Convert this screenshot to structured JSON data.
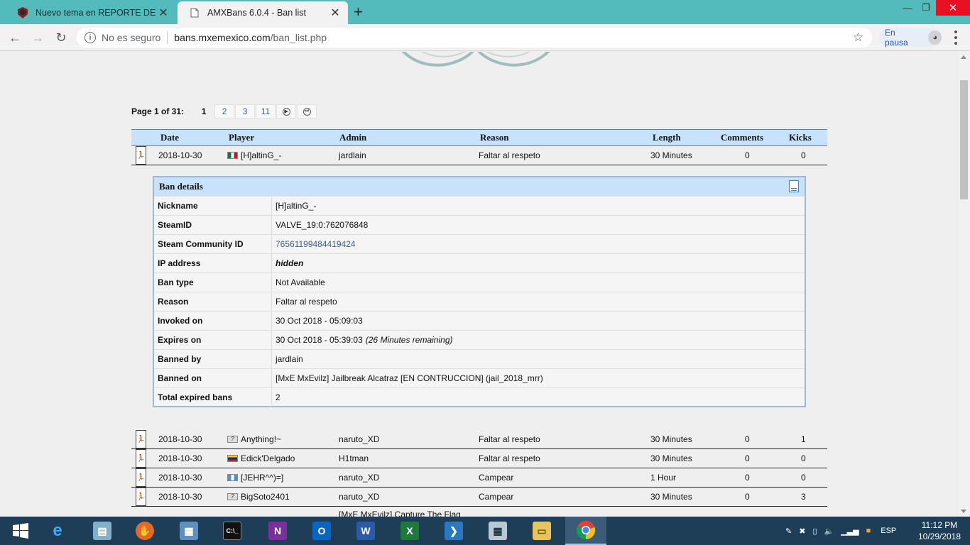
{
  "browser": {
    "tabs": [
      {
        "title": "Nuevo tema en REPORTE DE ABU",
        "active": false
      },
      {
        "title": "AMXBans 6.0.4 - Ban list",
        "active": true
      }
    ],
    "new_tab": "+",
    "security": "No es seguro",
    "url_host": "bans.mxemexico.com",
    "url_path": "/ban_list.php",
    "profile_status": "En pausa"
  },
  "pager": {
    "label": "Page 1 of 31:",
    "pages": [
      "1",
      "2",
      "3",
      "11"
    ],
    "current": "1"
  },
  "table": {
    "columns": [
      "Date",
      "Player",
      "Admin",
      "Reason",
      "Length",
      "Comments",
      "Kicks"
    ],
    "first_row": {
      "date": "2018-10-30",
      "flag": "mx",
      "player": "[H]altinG_-",
      "admin": "jardlain",
      "reason": "Faltar al respeto",
      "length": "30 Minutes",
      "comments": "0",
      "kicks": "0"
    },
    "rows": [
      {
        "date": "2018-10-30",
        "flag": "unk",
        "player": "Anything!~",
        "admin": "naruto_XD",
        "reason": "Faltar al respeto",
        "length": "30 Minutes",
        "comments": "0",
        "kicks": "1"
      },
      {
        "date": "2018-10-30",
        "flag": "ve",
        "player": "Edick'Delgado",
        "admin": "H1tman",
        "reason": "Faltar al respeto",
        "length": "30 Minutes",
        "comments": "0",
        "kicks": "0"
      },
      {
        "date": "2018-10-30",
        "flag": "gt",
        "player": "[JEHR^^)=]",
        "admin": "naruto_XD",
        "reason": "Campear",
        "length": "1 Hour",
        "comments": "0",
        "kicks": "0"
      },
      {
        "date": "2018-10-30",
        "flag": "unk",
        "player": "BigSoto2401",
        "admin": "naruto_XD",
        "reason": "Campear",
        "length": "30 Minutes",
        "comments": "0",
        "kicks": "3"
      }
    ],
    "cut_text": "[MxE MxEvilz] Capture The Flag"
  },
  "details": {
    "title": "Ban details",
    "rows": [
      {
        "key": "Nickname",
        "value": "[H]altinG_-"
      },
      {
        "key": "SteamID",
        "value": "VALVE_19:0:762076848"
      },
      {
        "key": "Steam Community ID",
        "value": "76561199484419424",
        "style": "link"
      },
      {
        "key": "IP address",
        "value": "hidden",
        "style": "it"
      },
      {
        "key": "Ban type",
        "value": "Not Available"
      },
      {
        "key": "Reason",
        "value": "Faltar al respeto"
      },
      {
        "key": "Invoked on",
        "value": "30 Oct 2018 - 05:09:03"
      },
      {
        "key": "Expires on",
        "value": "30 Oct 2018 - 05:39:03",
        "extra": "(26 Minutes remaining)"
      },
      {
        "key": "Banned by",
        "value": "jardlain"
      },
      {
        "key": "Banned on",
        "value": "[MxE MxEvilz] Jailbreak Alcatraz [EN CONTRUCCION] (jail_2018_mrr)"
      },
      {
        "key": "Total expired bans",
        "value": "2"
      }
    ]
  },
  "taskbar": {
    "lang": "ESP",
    "time": "11:12 PM",
    "date": "10/29/2018"
  }
}
